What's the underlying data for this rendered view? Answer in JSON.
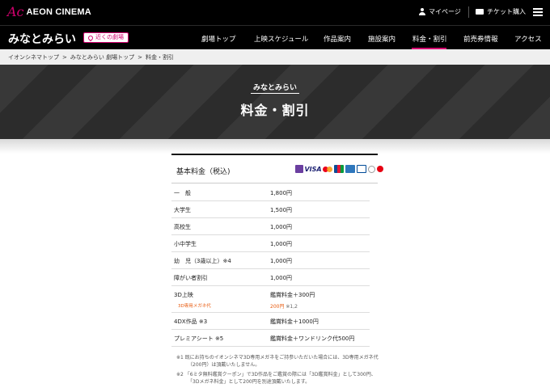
{
  "header": {
    "logo_mark": "Ac",
    "logo_text": "AEON CINEMA",
    "mypage": "マイページ",
    "ticket": "チケット購入"
  },
  "theater": {
    "name": "みなとみらい",
    "nearby": "近くの劇場"
  },
  "nav": [
    "劇場トップ",
    "上映スケジュール",
    "作品案内",
    "施設案内",
    "料金・割引",
    "前売券情報",
    "アクセス"
  ],
  "breadcrumb": [
    "イオンシネマトップ",
    "みなとみらい 劇場トップ",
    "料金・割引"
  ],
  "hero": {
    "subtitle": "みなとみらい",
    "title": "料金・割引"
  },
  "price_table": {
    "title": "基本料金（税込)",
    "payment_icons": [
      "cinema-card-icon",
      "visa-icon",
      "mastercard-icon",
      "jcb-icon",
      "amex-icon",
      "diners-icon",
      "discover-icon",
      "rakuten-icon"
    ],
    "rows": [
      {
        "label": "一　般",
        "value": "1,800円"
      },
      {
        "label": "大学生",
        "value": "1,500円"
      },
      {
        "label": "高校生",
        "value": "1,000円"
      },
      {
        "label": "小中学生",
        "value": "1,000円"
      },
      {
        "label": "幼　児（3歳以上）※4",
        "value": "1,000円"
      },
      {
        "label": "障がい者割引",
        "value": "1,000円"
      },
      {
        "label": "3D上映",
        "value": "鑑賞料金＋300円",
        "sub_label": "3D専用メガネ代",
        "sub_value": "200円",
        "sub_note": "※1,2"
      },
      {
        "label": "4DX作品 ※3",
        "value": "鑑賞料金＋1000円"
      },
      {
        "label": "プレミアシート ※5",
        "value": "鑑賞料金＋ワンドリンク代500円"
      }
    ]
  },
  "notes": [
    "※1 既にお持ちのイオンシネマ3D専用メガネをご持参いただいた場合には、3D専用メガネ代（200円）は頂戴いたしません。",
    "※2 「6ミタ無料鑑賞クーポン」で3D作品をご鑑賞の際には「3D鑑賞料金」として300円、「3Dメガネ料金」として200円を別途頂戴いたします。"
  ]
}
